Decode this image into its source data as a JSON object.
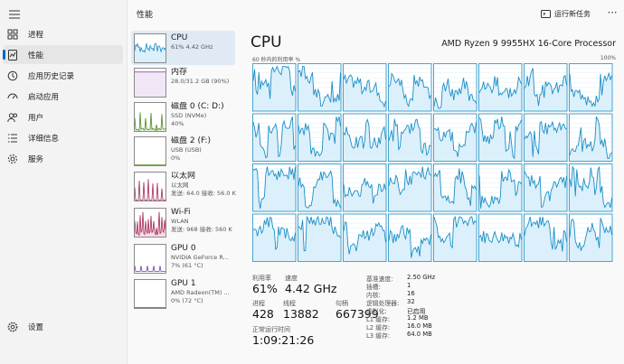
{
  "colors": {
    "accent": "#0067c0",
    "cpu_line": "#1a8fc7",
    "cpu_fill": "#dcf0fb",
    "grid": "#d6e9f5"
  },
  "nav": {
    "items": [
      {
        "label": "进程",
        "icon": "processes-icon"
      },
      {
        "label": "性能",
        "icon": "performance-icon",
        "active": true
      },
      {
        "label": "应用历史记录",
        "icon": "app-history-icon"
      },
      {
        "label": "启动应用",
        "icon": "startup-icon"
      },
      {
        "label": "用户",
        "icon": "users-icon"
      },
      {
        "label": "详细信息",
        "icon": "details-icon"
      },
      {
        "label": "服务",
        "icon": "services-icon"
      }
    ],
    "settings_label": "设置"
  },
  "header": {
    "title": "性能",
    "run_task_label": "运行新任务",
    "more": "⋯"
  },
  "tiles": [
    {
      "name": "CPU",
      "l1": "61% 4.42 GHz",
      "l2": "",
      "selected": true
    },
    {
      "name": "内存",
      "l1": "28.0/31.2 GB (90%)",
      "l2": ""
    },
    {
      "name": "磁盘 0 (C: D:)",
      "l1": "SSD (NVMe)",
      "l2": "40%"
    },
    {
      "name": "磁盘 2 (F:)",
      "l1": "USB (USB)",
      "l2": "0%"
    },
    {
      "name": "以太网",
      "l1": "以太网",
      "l2": "发送: 64.0 接收: 56.0 K"
    },
    {
      "name": "Wi-Fi",
      "l1": "WLAN",
      "l2": "发送: 968 接收: 560 K"
    },
    {
      "name": "GPU 0",
      "l1": "NVIDIA GeForce R...",
      "l2": "7% (61 °C)"
    },
    {
      "name": "GPU 1",
      "l1": "AMD Radeon(TM) ...",
      "l2": "0% (72 °C)"
    }
  ],
  "cpu": {
    "heading": "CPU",
    "model": "AMD Ryzen 9 9955HX 16-Core Processor",
    "graph_label_left": "60 秒内的利用率 %",
    "graph_label_right": "100%",
    "stats": {
      "utilization_label": "利用率",
      "utilization": "61%",
      "speed_label": "速度",
      "speed": "4.42 GHz",
      "processes_label": "进程",
      "processes": "428",
      "threads_label": "线程",
      "threads": "13882",
      "handles_label": "句柄",
      "handles": "667399",
      "uptime_label": "正常运行时间",
      "uptime": "1:09:21:26"
    },
    "specs": [
      {
        "k": "基准速度:",
        "v": "2.50 GHz"
      },
      {
        "k": "插槽:",
        "v": "1"
      },
      {
        "k": "内核:",
        "v": "16"
      },
      {
        "k": "逻辑处理器:",
        "v": "32"
      },
      {
        "k": "虚拟化:",
        "v": "已启用"
      },
      {
        "k": "L1 缓存:",
        "v": "1.2 MB"
      },
      {
        "k": "L2 缓存:",
        "v": "16.0 MB"
      },
      {
        "k": "L3 缓存:",
        "v": "64.0 MB"
      }
    ]
  }
}
